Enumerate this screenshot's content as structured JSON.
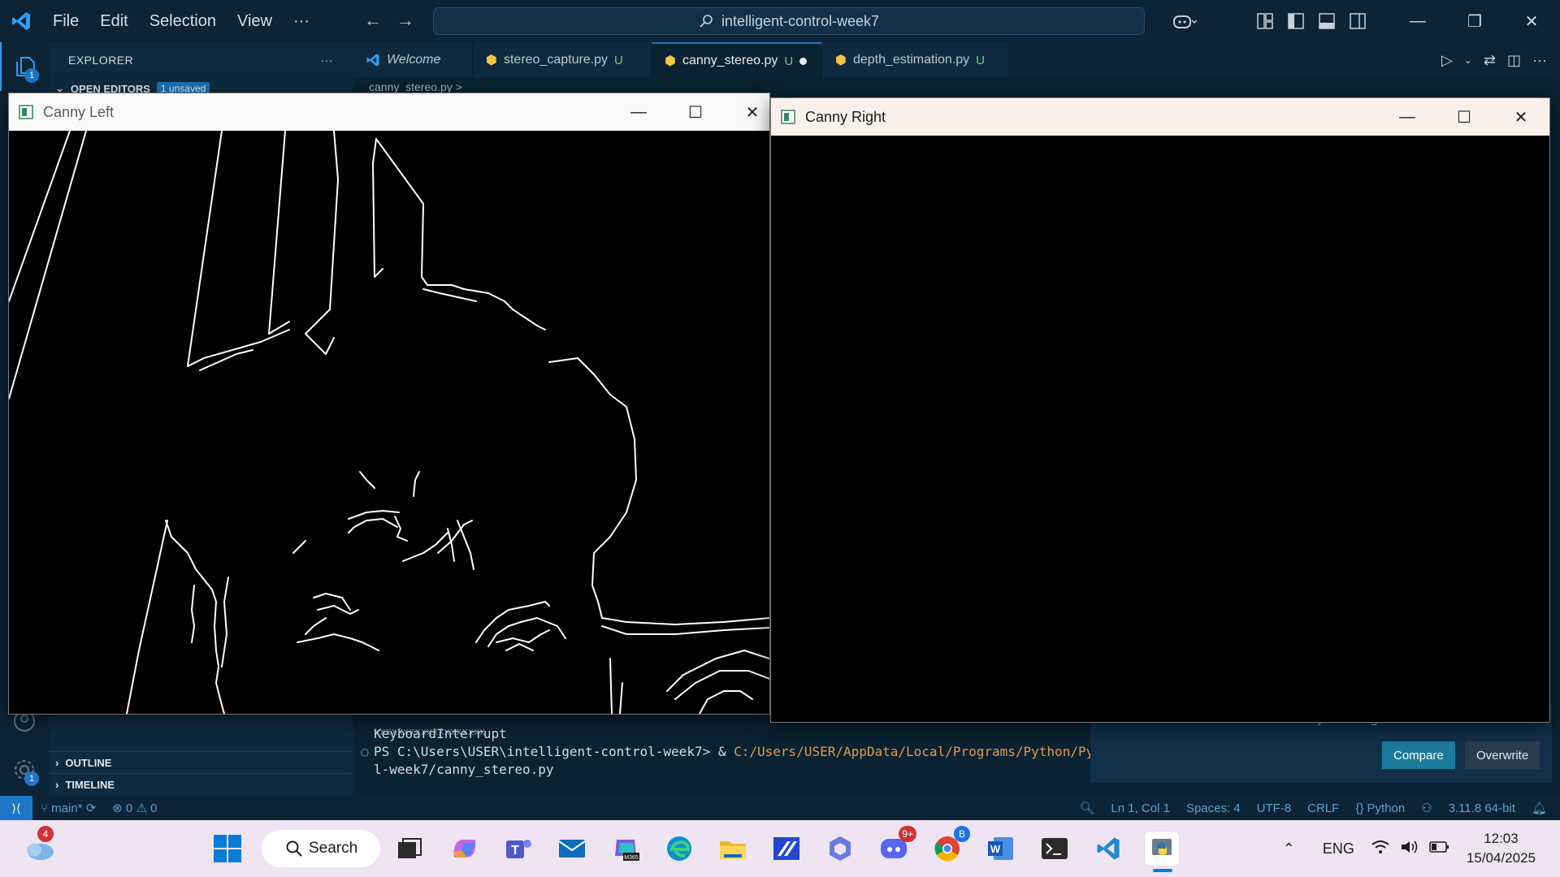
{
  "titlebar": {
    "menu": [
      "File",
      "Edit",
      "Selection",
      "View",
      "···"
    ],
    "command_center": "intelligent-control-week7"
  },
  "sidebar": {
    "title": "EXPLORER",
    "more": "···",
    "open_editors": "OPEN EDITORS",
    "unsaved_badge": "1 unsaved",
    "outline": "OUTLINE",
    "timeline": "TIMELINE",
    "explorer_badge": "1",
    "settings_badge": "1"
  },
  "tabs": [
    {
      "label": "Welcome",
      "status": ""
    },
    {
      "label": "stereo_capture.py",
      "status": "U"
    },
    {
      "label": "canny_stereo.py",
      "status": "U"
    },
    {
      "label": "depth_estimation.py",
      "status": "U"
    }
  ],
  "breadcrumb": "canny_stereo.py >",
  "terminal": {
    "line1": "KeyboardInterrupt",
    "line2_prompt": "PS C:\\Users\\USER\\intelligent-control-week7> & ",
    "line2_path": "C:/Users/USER/AppData/Local/Programs/Python/Python31",
    "line3": "l-week7/canny_stereo.py"
  },
  "notification": {
    "text": "overwrite the content of the file with your changes.",
    "compare": "Compare",
    "overwrite": "Overwrite"
  },
  "statusbar": {
    "branch": "main*",
    "problems": "⊗ 0 ⚠ 0",
    "position": "Ln 1, Col 1",
    "spaces": "Spaces: 4",
    "encoding": "UTF-8",
    "eol": "CRLF",
    "language": "{} Python",
    "interpreter": "3.11.8 64-bit"
  },
  "windows": {
    "left_title": "Canny Left",
    "right_title": "Canny Right"
  },
  "taskbar": {
    "search": "Search",
    "weather_badge": "4",
    "discord_badge": "9+",
    "chrome_badge": "B",
    "lang": "ENG",
    "time": "12:03",
    "date": "15/04/2025"
  }
}
